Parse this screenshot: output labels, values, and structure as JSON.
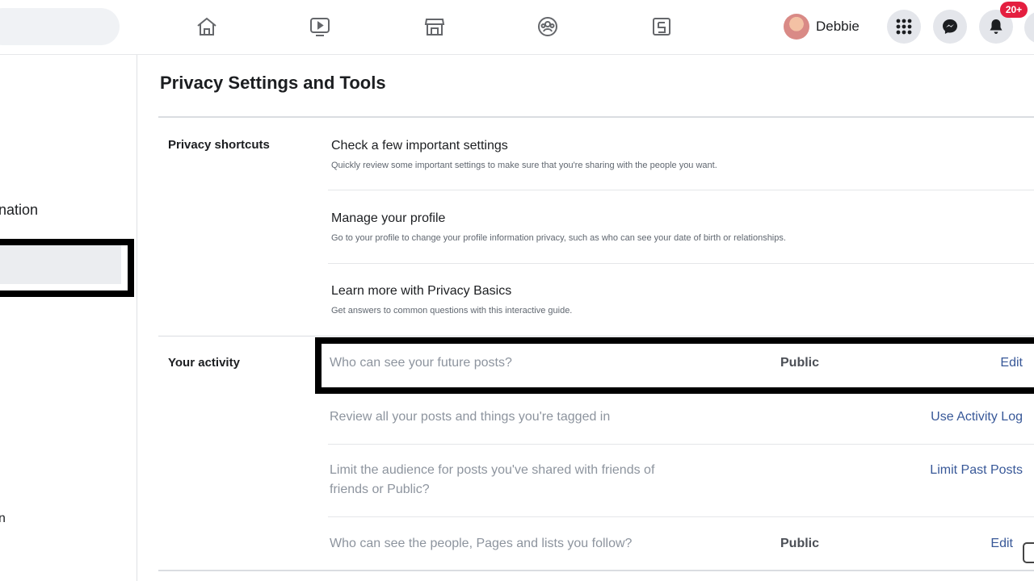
{
  "header": {
    "profile_name": "Debbie",
    "notification_count": "20+",
    "nav_icons": [
      "home-icon",
      "watch-icon",
      "marketplace-icon",
      "groups-icon",
      "gaming-icon"
    ]
  },
  "sidebar": {
    "partial_item_label": "nation",
    "partial_bottom_char": "n"
  },
  "main": {
    "title": "Privacy Settings and Tools",
    "sections": [
      {
        "label": "Privacy shortcuts",
        "items": [
          {
            "title": "Check a few important settings",
            "description": "Quickly review some important settings to make sure that you're sharing with the people you want."
          },
          {
            "title": "Manage your profile",
            "description": "Go to your profile to change your profile information privacy, such as who can see your date of birth or relationships."
          },
          {
            "title": "Learn more with Privacy Basics",
            "description": "Get answers to common questions with this interactive guide."
          }
        ]
      },
      {
        "label": "Your activity",
        "items": [
          {
            "text": "Who can see your future posts?",
            "value": "Public",
            "action": "Edit"
          },
          {
            "text": "Review all your posts and things you're tagged in",
            "value": "",
            "action": "Use Activity Log"
          },
          {
            "text": "Limit the audience for posts you've shared with friends of friends or Public?",
            "value": "",
            "action": "Limit Past Posts"
          },
          {
            "text": "Who can see the people, Pages and lists you follow?",
            "value": "Public",
            "action": "Edit"
          }
        ]
      }
    ]
  },
  "colors": {
    "link": "#385898",
    "badge": "#e41e3f",
    "highlight_border": "#000000"
  }
}
